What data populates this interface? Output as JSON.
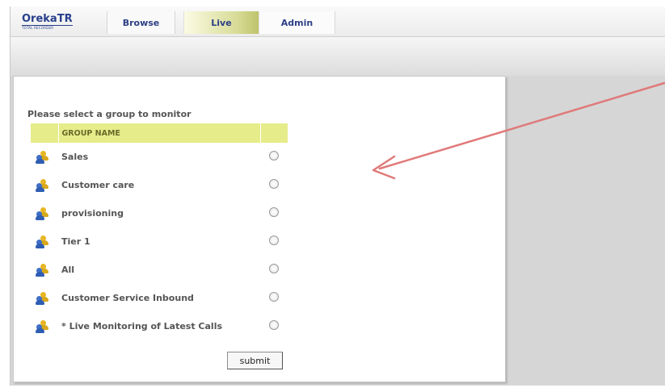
{
  "logo": {
    "main": "OrekaTR",
    "sub": "TOTAL RECORDER"
  },
  "nav": {
    "tabs": [
      {
        "label": "Browse"
      },
      {
        "label": "Live",
        "active": true
      },
      {
        "label": "Admin"
      }
    ]
  },
  "main": {
    "prompt": "Please select a group to monitor",
    "table": {
      "header": "GROUP NAME",
      "groups": [
        {
          "name": "Sales"
        },
        {
          "name": "Customer care"
        },
        {
          "name": "provisioning"
        },
        {
          "name": "Tier 1"
        },
        {
          "name": "All"
        },
        {
          "name": "Customer Service Inbound"
        },
        {
          "name": "* Live Monitoring of Latest Calls"
        }
      ]
    },
    "submit_label": "submit"
  },
  "colors": {
    "header_bg": "#e6ec8a",
    "live_tab": "#d8dc98",
    "nav_text": "#2c3f86",
    "arrow": "#e07a7a"
  },
  "icons": {
    "group_icon": "users-group-icon"
  }
}
